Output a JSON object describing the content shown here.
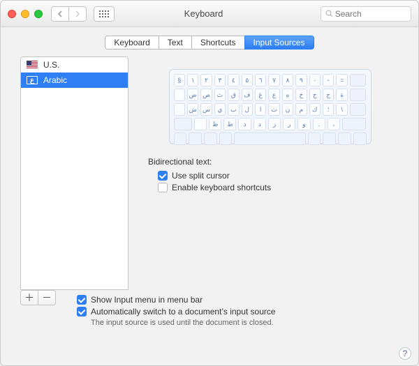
{
  "window": {
    "title": "Keyboard"
  },
  "search": {
    "placeholder": "Search"
  },
  "tabs": [
    "Keyboard",
    "Text",
    "Shortcuts",
    "Input Sources"
  ],
  "activeTab": 3,
  "sources": {
    "items": [
      {
        "label": "U.S.",
        "flag": "us"
      },
      {
        "label": "Arabic",
        "flag": "ar"
      }
    ],
    "selectedIndex": 1
  },
  "keyboard_rows": [
    [
      "§",
      "١",
      "٢",
      "٣",
      "٤",
      "٥",
      "٦",
      "٧",
      "٨",
      "٩",
      "٠",
      "-",
      "="
    ],
    [
      "",
      "ض",
      "ص",
      "ث",
      "ق",
      "ف",
      "غ",
      "ع",
      "ه",
      "خ",
      "ح",
      "ج",
      "ة"
    ],
    [
      "",
      "ش",
      "س",
      "ي",
      "ب",
      "ل",
      "ا",
      "ت",
      "ن",
      "م",
      "ك",
      "؛",
      "\\"
    ],
    [
      "",
      "ظ",
      "ط",
      "ذ",
      "د",
      "ز",
      "ر",
      "و",
      ".",
      "،"
    ]
  ],
  "bidi": {
    "label": "Bidirectional text:",
    "opt1": "Use split cursor",
    "opt2": "Enable keyboard shortcuts",
    "opt1_checked": true,
    "opt2_checked": false
  },
  "footer": {
    "showMenu": "Show Input menu in menu bar",
    "autoSwitch": "Automatically switch to a document’s input source",
    "hint": "The input source is used until the document is closed.",
    "showMenu_checked": true,
    "autoSwitch_checked": true
  }
}
